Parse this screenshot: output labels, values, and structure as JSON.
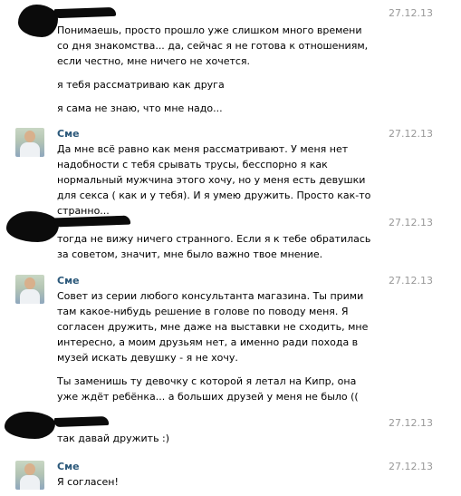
{
  "messages": [
    {
      "sender": "",
      "date": "27.12.13",
      "paragraphs": [
        "Понимаешь, просто прошло уже слишком много времени со дня знакомства... да, сейчас я не готова к отношениям, если честно, мне ничего не хочется.",
        "я тебя рассматриваю как друга",
        "я сама не знаю, что мне надо..."
      ]
    },
    {
      "sender": "Сме",
      "date": "27.12.13",
      "paragraphs": [
        "Да мне всё равно как меня рассматривают. У меня нет надобности с тебя срывать трусы, бесспорно я как нормальный мужчина этого хочу, но у меня есть девушки для секса ( как и у тебя). И я умею дружить. Просто как-то странно..."
      ]
    },
    {
      "sender": "",
      "date": "27.12.13",
      "paragraphs": [
        "тогда не вижу ничего странного. Если я к тебе обратилась за советом, значит, мне было важно твое мнение."
      ]
    },
    {
      "sender": "Сме",
      "date": "27.12.13",
      "paragraphs": [
        "Совет из серии любого консультанта магазина. Ты прими там какое-нибудь решение в голове по поводу меня. Я согласен дружить, мне даже на выставки не сходить, мне интересно, а моим друзьям нет, а именно ради похода в музей искать девушку - я не хочу.",
        "Ты заменишь ту девочку с которой я летал на Кипр, она уже ждёт ребёнка... а больших друзей у меня не было (("
      ]
    },
    {
      "sender": "",
      "date": "27.12.13",
      "paragraphs": [
        "так давай дружить :)"
      ]
    },
    {
      "sender": "Сме",
      "date": "27.12.13",
      "paragraphs": [
        "Я согласен!"
      ]
    }
  ]
}
